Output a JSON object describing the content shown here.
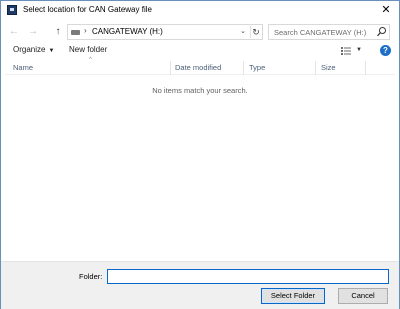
{
  "window": {
    "title": "Select location for CAN Gateway file",
    "close_glyph": "✕"
  },
  "nav": {
    "back_glyph": "←",
    "forward_glyph": "→",
    "up_glyph": "↑",
    "breadcrumb_separator": "›",
    "location": "CANGATEWAY (H:)",
    "dropdown_glyph": "⌄",
    "refresh_glyph": "↻",
    "search_placeholder": "Search CANGATEWAY (H:)"
  },
  "toolbar": {
    "organize_label": "Organize",
    "organize_caret": "▼",
    "new_folder_label": "New folder",
    "view_caret": "▼",
    "help_glyph": "?"
  },
  "columns": {
    "name": "Name",
    "date_modified": "Date modified",
    "type": "Type",
    "size": "Size",
    "sort_glyph": "^"
  },
  "content": {
    "empty_message": "No items match your search."
  },
  "footer": {
    "folder_label": "Folder:",
    "folder_value": "",
    "select_button": "Select Folder",
    "cancel_button": "Cancel"
  },
  "colors": {
    "window_border": "#6a8fb8",
    "column_header_text": "#4c607a",
    "accent": "#0a67c9",
    "help_icon": "#1f6ec5",
    "footer_bg": "#f0f0f0"
  },
  "icons": [
    "app-icon",
    "close-icon",
    "back-icon",
    "forward-icon",
    "up-icon",
    "drive-icon",
    "chevron-down-icon",
    "refresh-icon",
    "search-icon",
    "view-options-icon",
    "help-icon",
    "sort-arrow-icon"
  ]
}
